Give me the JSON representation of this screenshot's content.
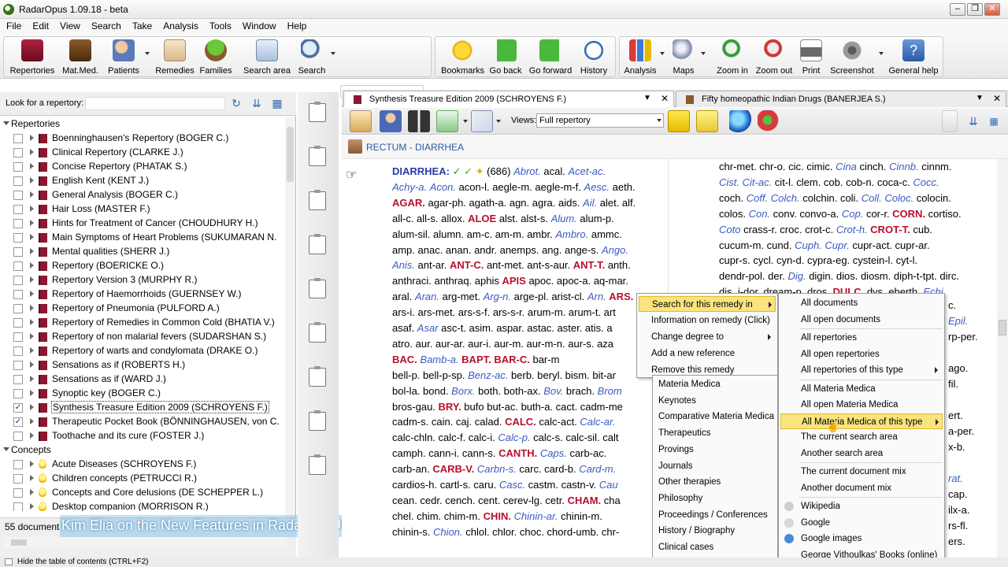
{
  "app": {
    "title": "RadarOpus 1.09.18 - beta"
  },
  "menu": [
    "File",
    "Edit",
    "View",
    "Search",
    "Take",
    "Analysis",
    "Tools",
    "Window",
    "Help"
  ],
  "toolbar": {
    "repertories": "Repertories",
    "matmed": "Mat.Med.",
    "patients": "Patients",
    "remedies": "Remedies",
    "families": "Families",
    "search_area": "Search area",
    "search": "Search",
    "bookmarks": "Bookmarks",
    "go_back": "Go back",
    "go_forward": "Go forward",
    "history": "History",
    "analysis": "Analysis",
    "maps": "Maps",
    "zoom_in": "Zoom in",
    "zoom_out": "Zoom out",
    "print": "Print",
    "screenshot": "Screenshot",
    "general_help": "General help"
  },
  "left": {
    "look_label": "Look for a repertory:",
    "repertories_group": "Repertories",
    "concepts_group": "Concepts",
    "repertories": [
      {
        "label": "Boenninghausen's Repertory (BOGER C.)",
        "checked": false
      },
      {
        "label": "Clinical Repertory (CLARKE J.)",
        "checked": false
      },
      {
        "label": "Concise Repertory (PHATAK S.)",
        "checked": false
      },
      {
        "label": "English Kent (KENT J.)",
        "checked": false
      },
      {
        "label": "General Analysis (BOGER C.)",
        "checked": false
      },
      {
        "label": "Hair Loss (MASTER F.)",
        "checked": false
      },
      {
        "label": "Hints for Treatment of Cancer (CHOUDHURY H.)",
        "checked": false
      },
      {
        "label": "Main Symptoms of Heart Problems (SUKUMARAN N.",
        "checked": false
      },
      {
        "label": "Mental qualities (SHERR J.)",
        "checked": false
      },
      {
        "label": "Repertory (BOERICKE O.)",
        "checked": false
      },
      {
        "label": "Repertory Version 3 (MURPHY R.)",
        "checked": false
      },
      {
        "label": "Repertory of Haemorrhoids (GUERNSEY W.)",
        "checked": false
      },
      {
        "label": "Repertory of Pneumonia (PULFORD A.)",
        "checked": false
      },
      {
        "label": "Repertory of Remedies in Common Cold (BHATIA V.)",
        "checked": false
      },
      {
        "label": "Repertory of non malarial fevers (SUDARSHAN S.)",
        "checked": false
      },
      {
        "label": "Repertory of warts and condylomata (DRAKE O.)",
        "checked": false
      },
      {
        "label": "Sensations as if (ROBERTS H.)",
        "checked": false
      },
      {
        "label": "Sensations as if (WARD J.)",
        "checked": false
      },
      {
        "label": "Synoptic key (BOGER C.)",
        "checked": false
      },
      {
        "label": "Synthesis Treasure Edition 2009 (SCHROYENS F.)",
        "checked": true
      },
      {
        "label": "Therapeutic Pocket Book (BÖNNINGHAUSEN, von C.",
        "checked": true
      },
      {
        "label": "Toothache and its cure (FOSTER J.)",
        "checked": false
      }
    ],
    "concepts": [
      {
        "label": "Acute Diseases (SCHROYENS F.)"
      },
      {
        "label": "Children concepts (PETRUCCI R.)"
      },
      {
        "label": "Concepts and Core delusions (DE SCHEPPER L.)"
      },
      {
        "label": "Desktop companion (MORRISON R.)"
      }
    ],
    "count_text": "55 document"
  },
  "overlay_caption": "Kim Elia on the New Features in Radar OPUS",
  "status": {
    "text": "Hide the table of contents (CTRL+F2)"
  },
  "tabs": [
    {
      "label": "Synthesis Treasure Edition 2009 (SCHROYENS F.)"
    },
    {
      "label": "Fifty homeopathic Indian Drugs (BANERJEA S.)"
    }
  ],
  "doc": {
    "views_label": "Views:",
    "views_value": "Full repertory",
    "rubric": "RECTUM - DIARRHEA",
    "left_lines": [
      [
        [
          "h",
          "DIARRHEA: "
        ],
        [
          "ck",
          "✓ "
        ],
        [
          "tk",
          "✓ "
        ],
        [
          "bl",
          "✦ "
        ],
        [
          "n",
          "(686) "
        ],
        [
          "i",
          "Abrot."
        ],
        [
          "n",
          " acal. "
        ],
        [
          "i",
          "Acet-ac."
        ]
      ],
      [
        [
          "i",
          "Achy-a."
        ],
        [
          "n",
          " "
        ],
        [
          "i",
          "Acon."
        ],
        [
          "n",
          " acon-l. aegle-m. aegle-m-f. "
        ],
        [
          "i",
          "Aesc."
        ],
        [
          "n",
          " aeth."
        ]
      ],
      [
        [
          "b",
          "AGAR."
        ],
        [
          "n",
          " agar-ph. agath-a. agn. agra. aids. "
        ],
        [
          "i",
          "Ail."
        ],
        [
          "n",
          " alet. alf."
        ]
      ],
      [
        [
          "n",
          "all-c. all-s. allox. "
        ],
        [
          "b",
          "ALOE"
        ],
        [
          "n",
          " alst. alst-s. "
        ],
        [
          "i",
          "Alum."
        ],
        [
          "n",
          " alum-p."
        ]
      ],
      [
        [
          "n",
          "alum-sil. alumn. am-c. am-m. ambr. "
        ],
        [
          "i",
          "Ambro."
        ],
        [
          "n",
          " ammc."
        ]
      ],
      [
        [
          "n",
          "amp. anac. anan. andr. anemps. ang. ange-s. "
        ],
        [
          "i",
          "Ango."
        ]
      ],
      [
        [
          "i",
          "Anis."
        ],
        [
          "n",
          " ant-ar. "
        ],
        [
          "b",
          "ANT-C."
        ],
        [
          "n",
          " ant-met. ant-s-aur. "
        ],
        [
          "b",
          "ANT-T."
        ],
        [
          "n",
          " anth."
        ]
      ],
      [
        [
          "n",
          "anthraci. anthraq. aphis "
        ],
        [
          "b",
          "APIS"
        ],
        [
          "n",
          " apoc. apoc-a. aq-mar."
        ]
      ],
      [
        [
          "n",
          "aral. "
        ],
        [
          "i",
          "Aran."
        ],
        [
          "n",
          " arg-met. "
        ],
        [
          "i",
          "Arg-n."
        ],
        [
          "n",
          " arge-pl. arist-cl. "
        ],
        [
          "i",
          "Arn."
        ],
        [
          "n",
          " "
        ],
        [
          "b",
          "ARS."
        ]
      ],
      [
        [
          "n",
          "ars-i. ars-met. ars-s-f. ars-s-r. arum-m. arum-t. art"
        ]
      ],
      [
        [
          "n",
          "asaf. "
        ],
        [
          "i",
          "Asar"
        ],
        [
          "n",
          " asc-t. asim. aspar. astac. aster. atis. a"
        ]
      ],
      [
        [
          "n",
          "atro. aur. aur-ar. aur-i. aur-m. aur-m-n. aur-s. aza"
        ]
      ],
      [
        [
          "b",
          "BAC."
        ],
        [
          "n",
          " "
        ],
        [
          "i",
          "Bamb-a."
        ],
        [
          "n",
          " "
        ],
        [
          "b",
          "BAPT."
        ],
        [
          "n",
          " "
        ],
        [
          "b",
          "BAR-C."
        ],
        [
          "n",
          " bar-m"
        ]
      ],
      [
        [
          "n",
          "bell-p. bell-p-sp. "
        ],
        [
          "i",
          "Benz-ac."
        ],
        [
          "n",
          " berb. beryl. bism. bit-ar"
        ]
      ],
      [
        [
          "n",
          "bol-la. bond. "
        ],
        [
          "i",
          "Borx."
        ],
        [
          "n",
          " both. both-ax. "
        ],
        [
          "i",
          "Bov."
        ],
        [
          "n",
          " brach. "
        ],
        [
          "i",
          "Brom"
        ]
      ],
      [
        [
          "n",
          "bros-gau. "
        ],
        [
          "b",
          "BRY."
        ],
        [
          "n",
          " bufo but-ac. buth-a. cact. cadm-me"
        ]
      ],
      [
        [
          "n",
          "cadm-s. cain. caj. calad. "
        ],
        [
          "b",
          "CALC."
        ],
        [
          "n",
          " calc-act. "
        ],
        [
          "i",
          "Calc-ar."
        ]
      ],
      [
        [
          "n",
          "calc-chln. calc-f. calc-i. "
        ],
        [
          "i",
          "Calc-p."
        ],
        [
          "n",
          " calc-s. calc-sil. calt"
        ]
      ],
      [
        [
          "n",
          "camph. cann-i. cann-s. "
        ],
        [
          "b",
          "CANTH."
        ],
        [
          "n",
          " "
        ],
        [
          "i",
          "Caps."
        ],
        [
          "n",
          " carb-ac."
        ]
      ],
      [
        [
          "n",
          "carb-an. "
        ],
        [
          "b",
          "CARB-V."
        ],
        [
          "n",
          " "
        ],
        [
          "i",
          "Carbn-s."
        ],
        [
          "n",
          " carc. card-b. "
        ],
        [
          "i",
          "Card-m."
        ]
      ],
      [
        [
          "n",
          "cardios-h. cartl-s. caru. "
        ],
        [
          "i",
          "Casc."
        ],
        [
          "n",
          " castm. castn-v. "
        ],
        [
          "i",
          "Cau"
        ]
      ],
      [
        [
          "n",
          "cean. cedr. cench. cent. cerev-lg. cetr. "
        ],
        [
          "b",
          "CHAM."
        ],
        [
          "n",
          " cha"
        ]
      ],
      [
        [
          "n",
          "chel. chim. chim-m. "
        ],
        [
          "b",
          "CHIN."
        ],
        [
          "n",
          " "
        ],
        [
          "i",
          "Chinin-ar."
        ],
        [
          "n",
          " chinin-m."
        ]
      ],
      [
        [
          "n",
          "chinin-s. "
        ],
        [
          "i",
          "Chion."
        ],
        [
          "n",
          " chlol. chlor. choc. chord-umb. chr-"
        ]
      ]
    ],
    "right_lines": [
      [
        [
          "n",
          "chr-met. chr-o. cic. cimic. "
        ],
        [
          "i",
          "Cina"
        ],
        [
          "n",
          " cinch. "
        ],
        [
          "i",
          "Cinnb."
        ],
        [
          "n",
          " cinnm."
        ]
      ],
      [
        [
          "i",
          "Cist."
        ],
        [
          "n",
          " "
        ],
        [
          "i",
          "Cit-ac."
        ],
        [
          "n",
          " cit-l. clem. cob. cob-n. coca-c. "
        ],
        [
          "i",
          "Cocc."
        ]
      ],
      [
        [
          "n",
          "coch. "
        ],
        [
          "i",
          "Coff."
        ],
        [
          "n",
          " "
        ],
        [
          "i",
          "Colch."
        ],
        [
          "n",
          " colchin. coli. "
        ],
        [
          "i",
          "Coll."
        ],
        [
          "n",
          " "
        ],
        [
          "i",
          "Coloc."
        ],
        [
          "n",
          " colocin."
        ]
      ],
      [
        [
          "n",
          "colos. "
        ],
        [
          "i",
          "Con."
        ],
        [
          "n",
          " conv. convo-a. "
        ],
        [
          "i",
          "Cop."
        ],
        [
          "n",
          " cor-r. "
        ],
        [
          "b",
          "CORN."
        ],
        [
          "n",
          " cortiso."
        ]
      ],
      [
        [
          "i",
          "Coto"
        ],
        [
          "n",
          " crass-r. croc. crot-c. "
        ],
        [
          "i",
          "Crot-h."
        ],
        [
          "n",
          " "
        ],
        [
          "b",
          "CROT-T."
        ],
        [
          "n",
          " cub."
        ]
      ],
      [
        [
          "n",
          "cucum-m. cund. "
        ],
        [
          "i",
          "Cuph."
        ],
        [
          "n",
          " "
        ],
        [
          "i",
          "Cupr."
        ],
        [
          "n",
          " cupr-act. cupr-ar."
        ]
      ],
      [
        [
          "n",
          "cupr-s. cycl. cyn-d. cypra-eg. cystein-l. cyt-l."
        ]
      ],
      [
        [
          "n",
          "dendr-pol. der. "
        ],
        [
          "i",
          "Dig."
        ],
        [
          "n",
          " digin. dios. diosm. diph-t-tpt. dirc."
        ]
      ],
      [
        [
          "n",
          "dis. i-dor. dream-p. dros. "
        ],
        [
          "b",
          "DULC."
        ],
        [
          "n",
          " dys. eberth. "
        ],
        [
          "i",
          "Echi."
        ]
      ]
    ],
    "right_tail": [
      "c. ",
      "Epil.",
      "rp-per.",
      "ago.",
      "fil.",
      "ert.",
      "a-per.",
      "x-b.",
      "rat.",
      "cap.",
      "ilx-a.",
      "rs-fl.",
      "ers.",
      "d-m."
    ]
  },
  "menus": {
    "menu1": [
      {
        "label": "Search for this remedy in",
        "sub": true,
        "hl": true
      },
      {
        "label": "Information on remedy (Click)"
      },
      {
        "label": "Change degree to",
        "sub": true
      },
      {
        "label": "Add a new reference"
      },
      {
        "label": "Remove this remedy"
      }
    ],
    "menu2": [
      "Materia Medica",
      "Keynotes",
      "Comparative Materia Medica",
      "Therapeutics",
      "Provings",
      "Journals",
      "Other therapies",
      "Philosophy",
      "Proceedings / Conferences",
      "History / Biography",
      "Clinical cases",
      "References"
    ],
    "menu3": [
      {
        "label": "All documents"
      },
      {
        "label": "All open documents"
      },
      {
        "sep": true
      },
      {
        "label": "All repertories"
      },
      {
        "label": "All open repertories"
      },
      {
        "label": "All repertories of this type",
        "sub": true
      },
      {
        "sep": true
      },
      {
        "label": "All Materia Medica"
      },
      {
        "label": "All open Materia Medica"
      },
      {
        "label": "All Materia Medica of this type",
        "sub": true,
        "hl": true
      },
      {
        "label": "The current search area"
      },
      {
        "label": "Another search area"
      },
      {
        "sep": true
      },
      {
        "label": "The current document mix"
      },
      {
        "label": "Another document mix"
      },
      {
        "sep": true
      },
      {
        "label": "Wikipedia",
        "icon": "wikipedia-icon"
      },
      {
        "label": "Google",
        "icon": "google-icon"
      },
      {
        "label": "Google images",
        "icon": "google-images-icon"
      },
      {
        "label": "George Vithoulkas' Books (online)"
      }
    ]
  },
  "colors": {
    "red_remedy": "#b8102e",
    "blue_remedy": "#3a5bc0",
    "highlight": "#fbe47e",
    "rubric": "#2a5aa0"
  }
}
